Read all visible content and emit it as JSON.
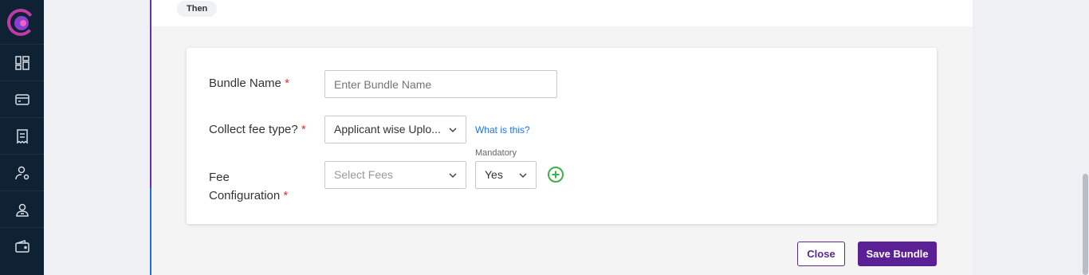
{
  "sidebar": {
    "items": [
      {
        "icon": "dashboard-icon"
      },
      {
        "icon": "card-icon"
      },
      {
        "icon": "receipt-icon"
      },
      {
        "icon": "user-settings-icon"
      },
      {
        "icon": "user-badge-icon"
      },
      {
        "icon": "wallet-icon"
      }
    ]
  },
  "flow": {
    "then_label": "Then"
  },
  "form": {
    "bundle_name": {
      "label": "Bundle Name",
      "required": "*",
      "placeholder": "Enter Bundle Name",
      "value": ""
    },
    "collect_fee_type": {
      "label": "Collect fee type?",
      "required": "*",
      "value": "Applicant wise Uplo...",
      "help_link": "What is this?"
    },
    "fee_configuration": {
      "label_line1": "Fee",
      "label_line2": "Configuration",
      "required": "*",
      "select_placeholder": "Select Fees",
      "mandatory_label": "Mandatory",
      "mandatory_value": "Yes"
    }
  },
  "actions": {
    "close_label": "Close",
    "save_label": "Save Bundle"
  },
  "colors": {
    "primary": "#5b1f96",
    "link": "#1a73e8",
    "required": "#dd3333",
    "add": "#3cb04a"
  }
}
